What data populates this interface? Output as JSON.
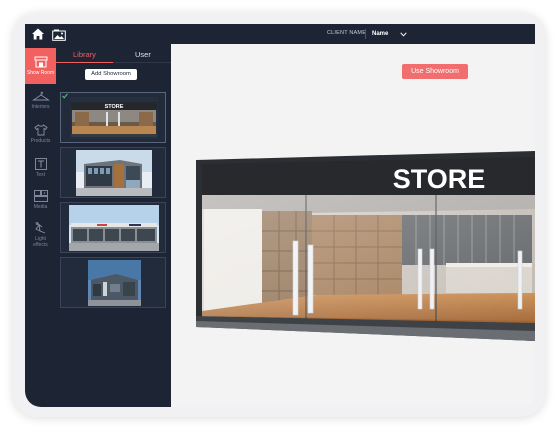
{
  "topbar": {
    "client_label": "CLIENT NAME",
    "name_value": "Name",
    "home_icon": "home-icon",
    "gallery_icon": "gallery-icon",
    "dropdown_icon": "chevron-down-icon"
  },
  "sidebar": {
    "items": [
      {
        "label": "Show Room",
        "icon": "storefront-icon",
        "active": true
      },
      {
        "label": "Interiors",
        "icon": "hanger-icon",
        "active": false
      },
      {
        "label": "Products",
        "icon": "tshirt-icon",
        "active": false
      },
      {
        "label": "Text",
        "icon": "text-icon",
        "active": false
      },
      {
        "label": "Media",
        "icon": "media-icon",
        "active": false
      },
      {
        "label": "Light effects",
        "icon": "lamp-icon",
        "active": false
      }
    ]
  },
  "library": {
    "tabs": [
      {
        "label": "Library",
        "active": true
      },
      {
        "label": "User",
        "active": false
      }
    ],
    "add_button": "Add Showroom",
    "thumbnails": [
      {
        "name": "Store interior",
        "selected": true,
        "sign_text": "STORE"
      },
      {
        "name": "Modern building exterior",
        "selected": false
      },
      {
        "name": "Strip mall exterior",
        "selected": false
      },
      {
        "name": "Warehouse building",
        "selected": false
      }
    ]
  },
  "canvas": {
    "use_button": "Use Showroom",
    "sign_text": "STORE"
  },
  "colors": {
    "dark": "#1d2535",
    "accent": "#f26060",
    "canvas": "#f3f3f3"
  }
}
